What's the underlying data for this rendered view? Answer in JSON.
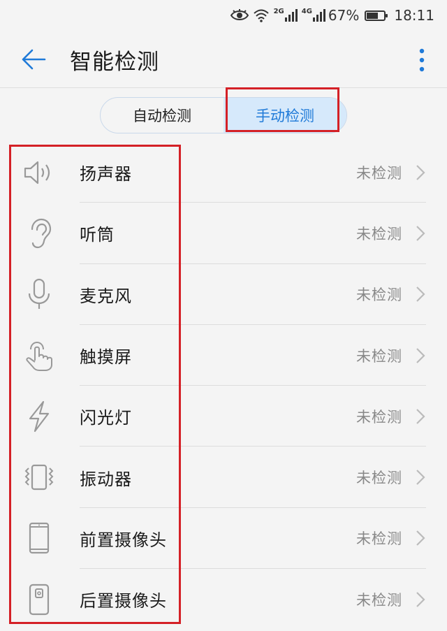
{
  "status_bar": {
    "network1": "2G",
    "network2": "4G",
    "battery_percent": "67%",
    "battery_level": 0.67,
    "time": "18:11"
  },
  "header": {
    "title": "智能检测"
  },
  "tabs": [
    {
      "label": "自动检测",
      "active": false
    },
    {
      "label": "手动检测",
      "active": true
    }
  ],
  "items": [
    {
      "label": "扬声器",
      "status": "未检测",
      "icon": "speaker-icon"
    },
    {
      "label": "听筒",
      "status": "未检测",
      "icon": "ear-icon"
    },
    {
      "label": "麦克风",
      "status": "未检测",
      "icon": "microphone-icon"
    },
    {
      "label": "触摸屏",
      "status": "未检测",
      "icon": "touch-hand-icon"
    },
    {
      "label": "闪光灯",
      "status": "未检测",
      "icon": "lightning-icon"
    },
    {
      "label": "振动器",
      "status": "未检测",
      "icon": "vibration-icon"
    },
    {
      "label": "前置摄像头",
      "status": "未检测",
      "icon": "front-camera-phone-icon"
    },
    {
      "label": "后置摄像头",
      "status": "未检测",
      "icon": "rear-camera-phone-icon"
    }
  ],
  "colors": {
    "accent": "#1f7ad8",
    "highlight": "#d42026"
  }
}
